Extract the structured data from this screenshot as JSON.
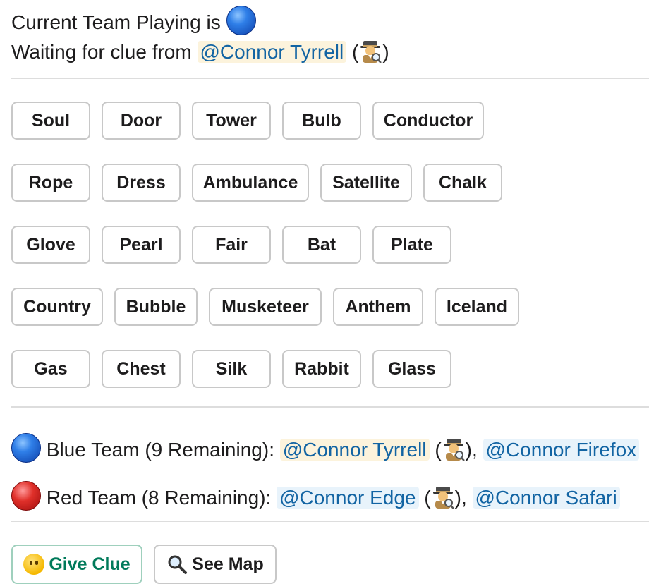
{
  "status": {
    "current_team_text": "Current Team Playing is",
    "waiting_text": "Waiting for clue from",
    "clue_giver": "@Connor Tyrrell",
    "paren_open": "(",
    "paren_close": ")"
  },
  "board": [
    [
      "Soul",
      "Door",
      "Tower",
      "Bulb",
      "Conductor"
    ],
    [
      "Rope",
      "Dress",
      "Ambulance",
      "Satellite",
      "Chalk"
    ],
    [
      "Glove",
      "Pearl",
      "Fair",
      "Bat",
      "Plate"
    ],
    [
      "Country",
      "Bubble",
      "Musketeer",
      "Anthem",
      "Iceland"
    ],
    [
      "Gas",
      "Chest",
      "Silk",
      "Rabbit",
      "Glass"
    ]
  ],
  "teams": {
    "blue": {
      "label": "Blue Team (9 Remaining):",
      "spymaster": "@Connor Tyrrell",
      "member": "@Connor Firefox",
      "paren_open": "(",
      "paren_close": "),"
    },
    "red": {
      "label": "Red Team (8 Remaining):",
      "spymaster": "@Connor Edge",
      "member": "@Connor Safari",
      "paren_open": "(",
      "paren_close": "),"
    }
  },
  "actions": {
    "give_clue": "Give Clue",
    "see_map": "See Map"
  },
  "icons": {
    "team_blue": "blue-circle-icon",
    "team_red": "red-circle-icon",
    "spymaster": "detective-icon",
    "give_clue": "thinking-face-icon",
    "see_map": "magnifying-glass-icon"
  },
  "colors": {
    "mention_text": "#1264a3",
    "highlight_bg": "#fcf3dc",
    "mention_bg": "#e8f3fb",
    "primary_green": "#007a5a"
  }
}
